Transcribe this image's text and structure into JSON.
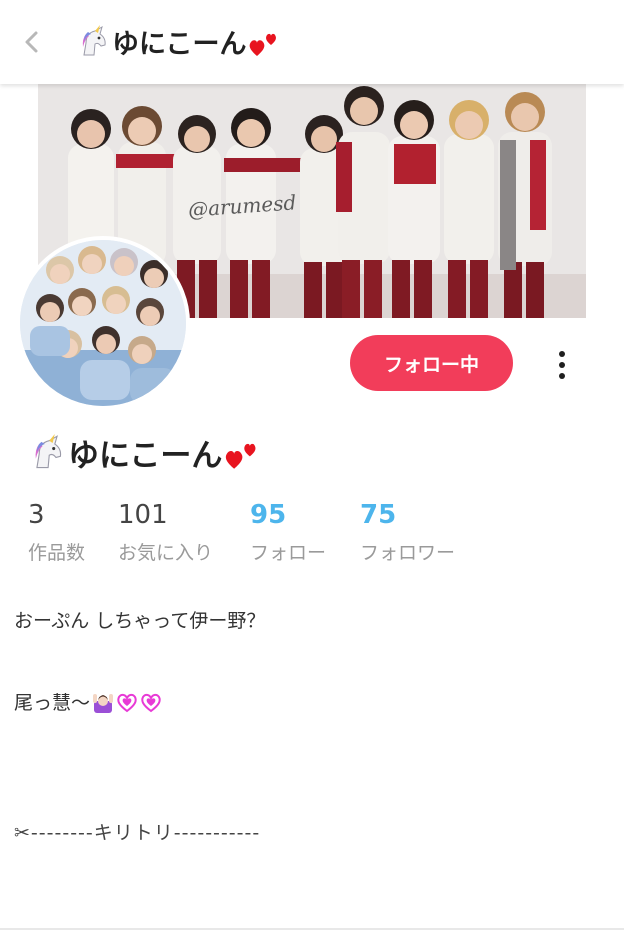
{
  "header": {
    "title": "ゆにこーん",
    "back_icon": "chevron-left-icon"
  },
  "cover": {
    "watermark": "@arumesd"
  },
  "actions": {
    "follow_label": "フォロー中",
    "more_icon": "more-vertical-icon"
  },
  "profile": {
    "name": "ゆにこーん"
  },
  "stats": [
    {
      "value": "3",
      "label": "作品数"
    },
    {
      "value": "101",
      "label": "お気に入り"
    },
    {
      "value": "95",
      "label": "フォロー"
    },
    {
      "value": "75",
      "label": "フォロワー"
    }
  ],
  "bio": {
    "line1": "おーぷん しちゃって伊ー野？",
    "line2": "尾っ慧〜",
    "line3": "✂--------キリトリ-----------"
  },
  "colors": {
    "accent": "#f23d5a",
    "link_blue": "#4db5ec"
  }
}
